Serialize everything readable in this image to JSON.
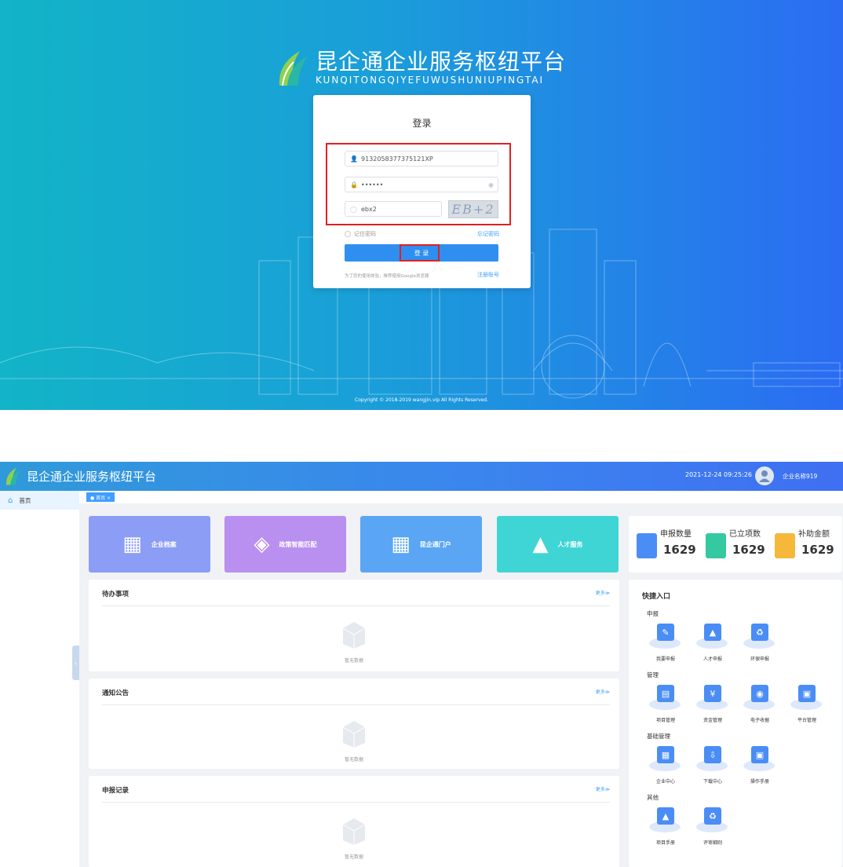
{
  "login": {
    "brand_title": "昆企通企业服务枢纽平台",
    "brand_sub": "KUNQITONGQIYEFUWUSHUNIUPINGTAI",
    "title": "登录",
    "username": "9132058377375121XP",
    "password": "••••••",
    "captcha_input": "ebx2",
    "captcha_image_text": "EB+2",
    "remember": "记住密码",
    "forgot": "忘记密码",
    "button": "登 录",
    "tip": "为了您的使用体验，推荐使用Google浏览器",
    "register": "注册账号",
    "copyright": "Copyright © 2018-2019 wangjin.vip All Rights Reserved.",
    "colors": {
      "bg_left": "#12b4c7",
      "bg_right": "#2b6cf3",
      "button": "#2e8ff0",
      "highlight": "#e02020"
    }
  },
  "dashboard": {
    "title": "昆企通企业服务枢纽平台",
    "datetime": "2021-12-24 09:25:26",
    "user": "企业名称919",
    "sidebar": [
      {
        "label": "首页",
        "icon": "home-icon"
      }
    ],
    "tabs": [
      {
        "label": "● 首页 ×"
      }
    ],
    "tiles": [
      {
        "label": "企业档案",
        "icon": "archive-icon",
        "color": "#8b9df5"
      },
      {
        "label": "政策智能匹配",
        "icon": "layers-icon",
        "color": "#b98ff0"
      },
      {
        "label": "昆企通门户",
        "icon": "archive-icon",
        "color": "#5aa6f4"
      },
      {
        "label": "人才服务",
        "icon": "graduation-cap-icon",
        "color": "#3fd5d5"
      }
    ],
    "stats": [
      {
        "label": "申报数量",
        "value": "1629",
        "color": "#4a8df5"
      },
      {
        "label": "已立项数",
        "value": "1629",
        "color": "#34c9a0"
      },
      {
        "label": "补助金额",
        "value": "1629",
        "color": "#f5b83a"
      }
    ],
    "panels": [
      {
        "title": "待办事项",
        "more": "更多≫",
        "empty": "暂无数据"
      },
      {
        "title": "通知公告",
        "more": "更多≫",
        "empty": "暂无数据"
      },
      {
        "title": "申报记录",
        "more": "更多≫",
        "empty": "暂无数据"
      }
    ],
    "quick": {
      "title": "快捷入口",
      "sections": [
        {
          "name": "申报",
          "items": [
            {
              "label": "我要申报",
              "icon": "edit-icon"
            },
            {
              "label": "人才申报",
              "icon": "graduation-cap-icon"
            },
            {
              "label": "环保申报",
              "icon": "recycle-icon"
            }
          ]
        },
        {
          "name": "管理",
          "items": [
            {
              "label": "项目管理",
              "icon": "folder-icon"
            },
            {
              "label": "资金管理",
              "icon": "money-icon"
            },
            {
              "label": "电子收据",
              "icon": "receipt-icon"
            },
            {
              "label": "平台管理",
              "icon": "monitor-icon"
            }
          ]
        },
        {
          "name": "基础管理",
          "items": [
            {
              "label": "企业中心",
              "icon": "building-icon"
            },
            {
              "label": "下载中心",
              "icon": "download-icon"
            },
            {
              "label": "操作手册",
              "icon": "book-icon"
            }
          ]
        },
        {
          "name": "其他",
          "items": [
            {
              "label": "项目手册",
              "icon": "graduation-cap-icon"
            },
            {
              "label": "评审细则",
              "icon": "recycle-icon"
            }
          ]
        }
      ]
    }
  }
}
